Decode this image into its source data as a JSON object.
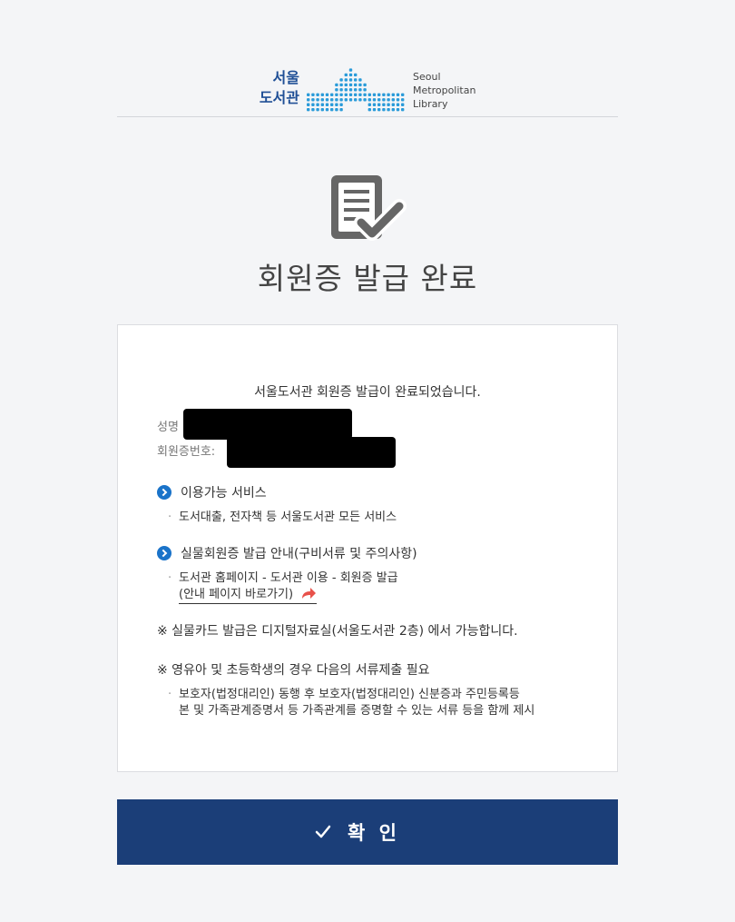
{
  "header": {
    "logo_kr_line1": "서울",
    "logo_kr_line2": "도서관",
    "logo_en_line1": "Seoul",
    "logo_en_line2": "Metropolitan",
    "logo_en_line3": "Library"
  },
  "page_title": "회원증 발급 완료",
  "card": {
    "message": "서울도서관 회원증 발급이 완료되었습니다.",
    "name_label": "성명",
    "card_no_label": "회원증번호:",
    "sections": [
      {
        "title": "이용가능 서비스",
        "lines": [
          "도서대출, 전자책 등 서울도서관 모든 서비스"
        ]
      },
      {
        "title": "실물회원증 발급 안내(구비서류 및 주의사항)",
        "lines": [
          "도서관 홈페이지 - 도서관 이용 - 회원증 발급"
        ],
        "link": "(안내 페이지 바로가기)"
      }
    ],
    "note1": "※ 실물카드 발급은 디지털자료실(서울도서관 2층) 에서 가능합니다.",
    "note2": "※ 영유아 및 초등학생의 경우 다음의 서류제출 필요",
    "note2_line1": "보호자(법정대리인) 동행 후 보호자(법정대리인) 신분증과 주민등록등",
    "note2_line2": "본 및 가족관계증명서 등 가족관계를 증명할 수 있는 서류 등을 함께 제시"
  },
  "confirm_button": "확 인",
  "colors": {
    "brand_blue": "#1f4f96",
    "logo_dot_blue": "#2a9bd9",
    "button_navy": "#1b3e78",
    "bullet_blue": "#1a73c9",
    "arrow_red": "#e8514a",
    "icon_gray": "#666666"
  }
}
